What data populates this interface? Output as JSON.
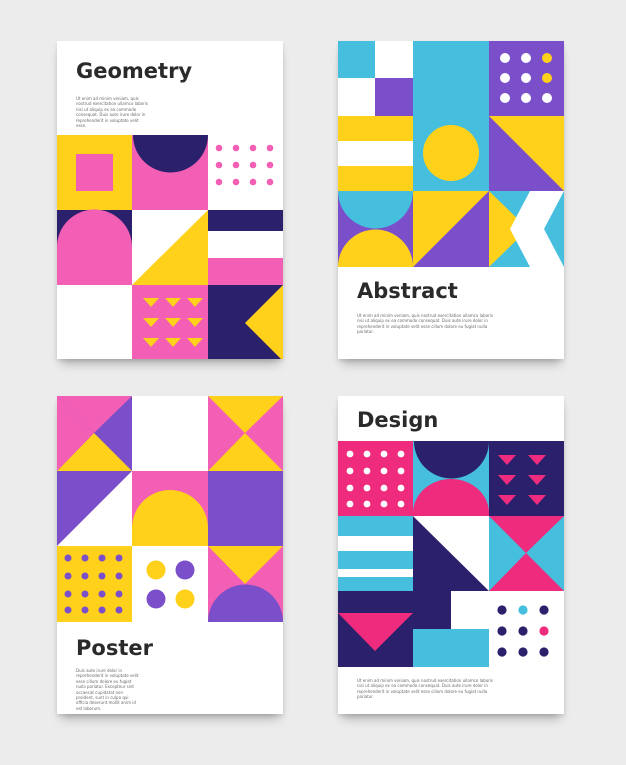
{
  "posters": [
    {
      "title": "Geometry",
      "body": "Ut enim ad minim veniam, quis nostrud exercitation ullamco laboris nisi ut aliquip ex ea commodo consequat. Duis aute irure dolor in reprehenderit in voluptate velit esse."
    },
    {
      "title": "Abstract",
      "body": "Ut enim ad minim veniam, quis nostrud exercitation ullamco laboris nisi ut aliquip ex ea commodo consequat. Duis aute irure dolor in reprehenderit in voluptate velit esse cillum dolore eu fugiat nulla pariatur."
    },
    {
      "title": "Poster",
      "body": "Duis aute irure dolor in reprehenderit in voluptate velit esse cillum dolore eu fugiat nulla pariatur. Excepteur sint occaecat cupidatat non proident, sunt in culpa qui officia deserunt mollit anim id est laborum."
    },
    {
      "title": "Design",
      "body": "Ut enim ad minim veniam, quis nostrud exercitation ullamco laboris nisi ut aliquip ex ea commodo consequat. Duis aute irure dolor in reprehenderit in voluptate velit esse cillum dolore eu fugiat nulla pariatur."
    }
  ],
  "colors": {
    "background": "#ececec",
    "paper": "#ffffff",
    "pink": "#f25fb4",
    "yellow": "#ffd11a",
    "navy": "#2a206b",
    "purple": "#7b4fc9",
    "cyan": "#45bfdd",
    "magenta": "#ee2b7c"
  }
}
